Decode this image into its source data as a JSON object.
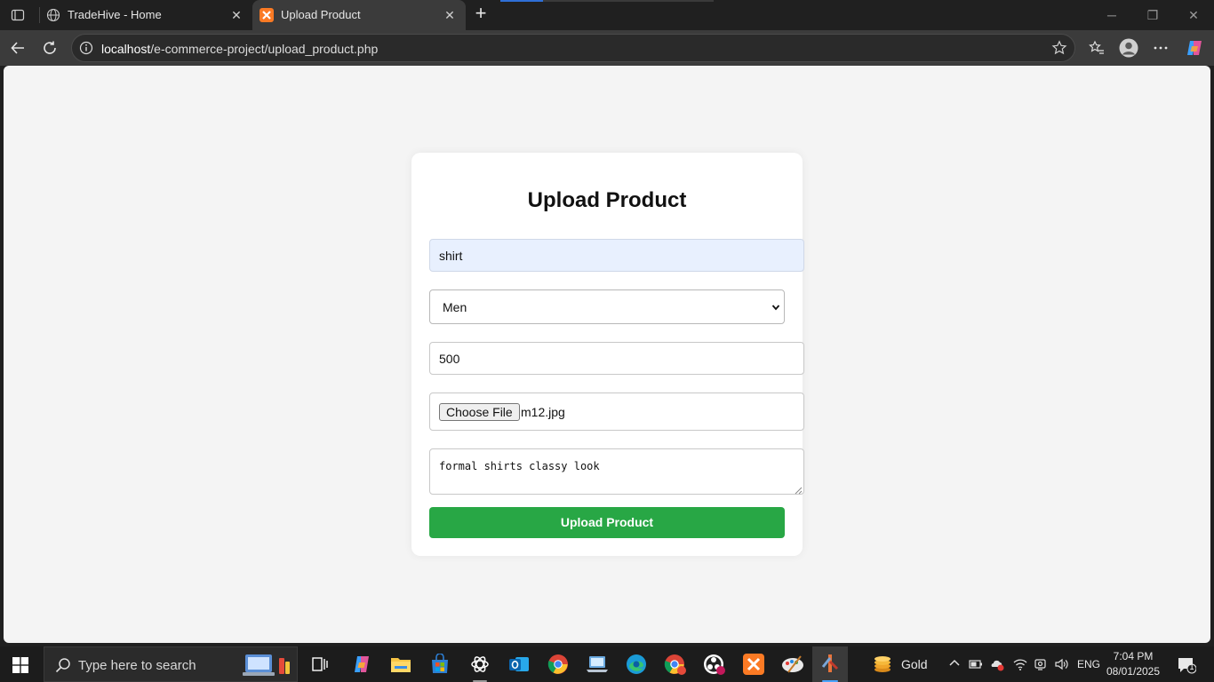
{
  "browser": {
    "tabs": [
      {
        "label": "TradeHive - Home",
        "active": false
      },
      {
        "label": "Upload Product",
        "active": true
      }
    ],
    "new_tab": "+",
    "url_host": "localhost",
    "url_path": "/e-commerce-project/upload_product.php"
  },
  "form": {
    "title": "Upload Product",
    "product_name": "shirt",
    "category": "Men",
    "price": "500",
    "file_button": "Choose File",
    "file_name": "m12.jpg",
    "description": "formal shirts classy look",
    "submit_label": "Upload Product",
    "colors": {
      "submit": "#28a745",
      "autofill": "#e8f0fe",
      "page_bg": "#f4f4f4"
    }
  },
  "taskbar": {
    "search_placeholder": "Type here to search",
    "weather_label": "Gold",
    "language": "ENG",
    "time": "7:04 PM",
    "date": "08/01/2025",
    "notification_count": "1",
    "apps": [
      "task-view",
      "copilot",
      "file-explorer",
      "microsoft-store",
      "chatgpt",
      "outlook",
      "chrome",
      "laptop-app",
      "edge",
      "chrome-profile",
      "obs",
      "xampp",
      "paint",
      "git-app"
    ]
  }
}
